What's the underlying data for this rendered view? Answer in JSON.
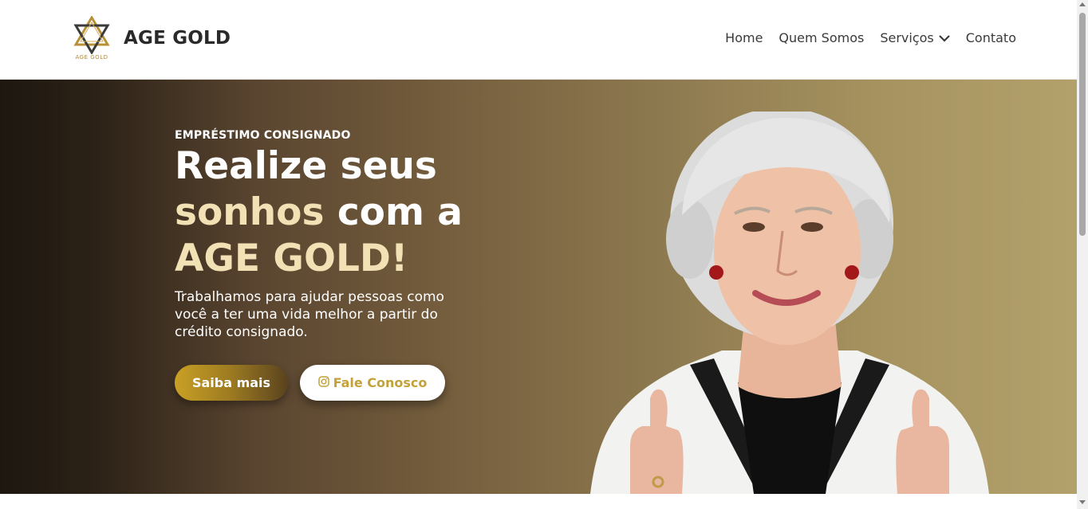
{
  "header": {
    "logo_small_text": "AGE GOLD",
    "brand": "AGE GOLD",
    "nav": [
      {
        "label": "Home"
      },
      {
        "label": "Quem Somos"
      },
      {
        "label": "Serviços"
      },
      {
        "label": "Contato"
      }
    ]
  },
  "hero": {
    "eyebrow": "EMPRÉSTIMO CONSIGNADO",
    "headline_part1": "Realize seus",
    "headline_accent": "sonhos",
    "headline_part2": " com a",
    "headline_accent2": "AGE GOLD!",
    "subtitle": "Trabalhamos para ajudar pessoas como você a ter uma vida melhor a partir do crédito consignado.",
    "primary_button": "Saiba mais",
    "secondary_button": "Fale Conosco"
  },
  "colors": {
    "gold_accent": "#c4a23a",
    "headline_accent": "#f3e1b6"
  },
  "icons": {
    "logo": "star-of-david-logo-icon",
    "dropdown": "chevron-down-icon",
    "instagram": "instagram-icon"
  }
}
